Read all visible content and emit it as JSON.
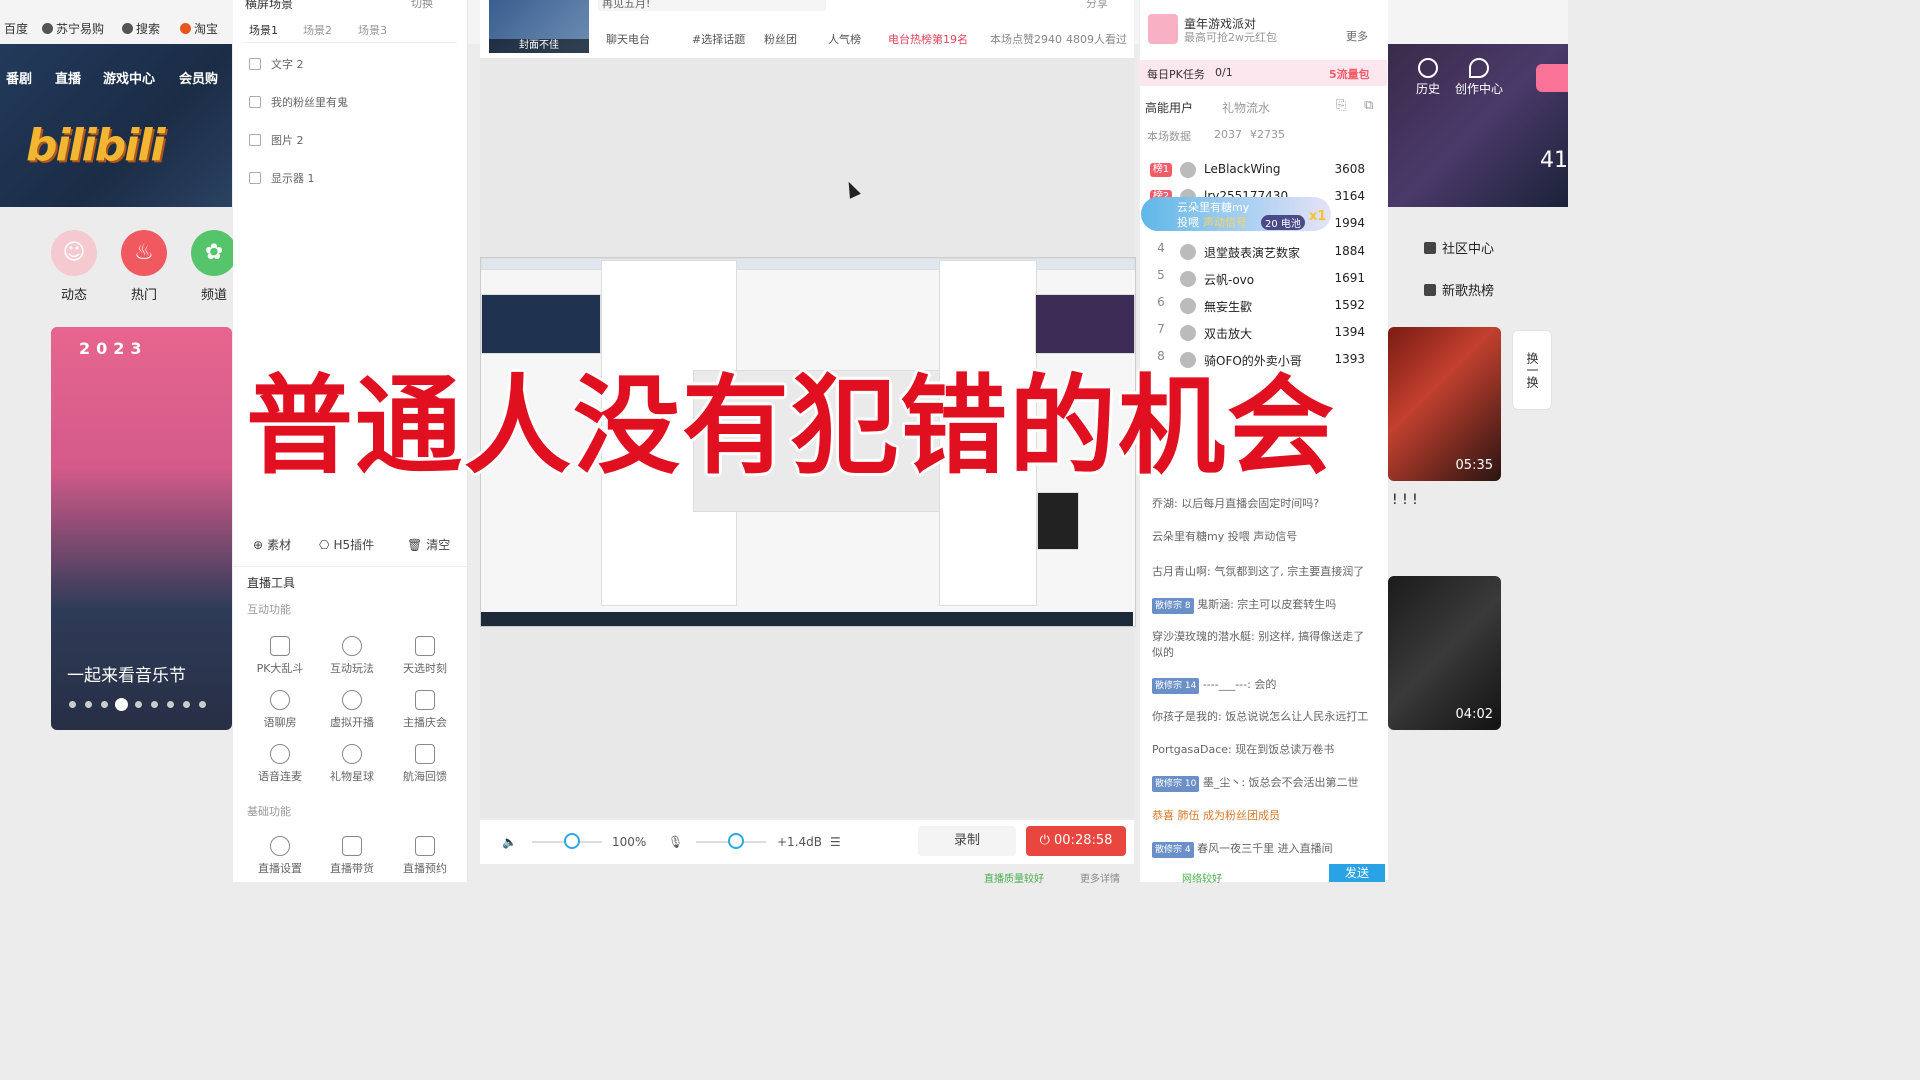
{
  "bookmarks": [
    "百度",
    "苏宁易购",
    "搜索",
    "淘宝"
  ],
  "site_nav": [
    "番剧",
    "直播",
    "游戏中心",
    "会员购"
  ],
  "logo_text": "bilibili",
  "header_right": {
    "history": "历史",
    "create": "创作中心",
    "number": "41"
  },
  "categories": [
    {
      "label": "动态",
      "icon": "avatar-icon"
    },
    {
      "label": "热门",
      "icon": "flame-icon"
    },
    {
      "label": "频道",
      "icon": "channel-icon"
    }
  ],
  "banner": {
    "year": "2023",
    "caption": "一起来看音乐节"
  },
  "right_links": [
    "社区中心",
    "新歌热榜"
  ],
  "refresh": {
    "label": "换一换"
  },
  "cards": [
    {
      "duration": "05:35"
    },
    {
      "duration": "04:02"
    }
  ],
  "exclaim": "! ! !",
  "scene": {
    "title": "横屏场景",
    "switch": "切换",
    "tabs": [
      "场景1",
      "场景2",
      "场景3"
    ],
    "sources": [
      "文字 2",
      "我的粉丝里有鬼",
      "图片 2",
      "显示器 1"
    ],
    "actions": [
      "素材",
      "H5插件",
      "清空"
    ],
    "tools_title": "直播工具",
    "interactive_title": "互动功能",
    "interactive_tools": [
      "PK大乱斗",
      "互动玩法",
      "天选时刻",
      "语聊房",
      "虚拟开播",
      "主播庆会",
      "语音连麦",
      "礼物星球",
      "航海回馈"
    ],
    "basic_title": "基础功能",
    "basic_tools": [
      "直播设置",
      "直播带货",
      "直播预约"
    ]
  },
  "stream": {
    "cover_label": "封面不佳",
    "title_partial": "再见五月!",
    "share": "分享",
    "tags": [
      "聊天电台",
      "#选择话题",
      "粉丝团",
      "人气榜",
      "电台热榜第19名"
    ],
    "likes": "本场点赞2940",
    "viewers": "4809人看过"
  },
  "controls": {
    "volume": "100%",
    "mic_gain": "+1.4dB",
    "record": "录制",
    "live_time": "00:28:58",
    "volume_level": 0.55,
    "mic_level": 0.55
  },
  "right": {
    "event_title": "童年游戏派对",
    "event_sub": "最高可抢2w元红包",
    "more": "更多",
    "pk_task": "每日PK任务",
    "pk_progress": "0/1",
    "pk_reward": "5流量包",
    "tab_high": "高能用户",
    "tab_gift": "礼物流水",
    "stats_label": "本场数据",
    "stats_users": "2037",
    "stats_money": "¥2735",
    "ranking": [
      {
        "rank": "榜1",
        "name": "LeBlackWing",
        "score": "3608"
      },
      {
        "rank": "榜2",
        "name": "lry255177430",
        "score": "3164"
      },
      {
        "rank": "3",
        "name": "",
        "score": "1994"
      },
      {
        "rank": "4",
        "name": "退堂鼓表演艺数家",
        "score": "1884"
      },
      {
        "rank": "5",
        "name": "云帆-ovo",
        "score": "1691"
      },
      {
        "rank": "6",
        "name": "無妄生歡",
        "score": "1592"
      },
      {
        "rank": "7",
        "name": "双击放大",
        "score": "1394"
      },
      {
        "rank": "8",
        "name": "骑OFO的外卖小哥",
        "score": "1393"
      }
    ],
    "gift_popup": {
      "user": "云朵里有糖my",
      "action": "投喂",
      "gift": "声动信号",
      "cost": "20 电池",
      "count": "x1"
    },
    "chat": [
      {
        "badge": "",
        "text": "乔湖: 以后每月直播会固定时间吗?"
      },
      {
        "badge": "",
        "text": "云朵里有糖my 投喂 声动信号"
      },
      {
        "badge": "",
        "text": "古月青山啊: 气氛都到这了, 宗主要直接润了"
      },
      {
        "badge": "散修宗 8",
        "text": "鬼斯涵: 宗主可以皮套转生吗"
      },
      {
        "badge": "",
        "text": "穿沙漠玫瑰的潜水艇: 别这样, 搞得像送走了似的"
      },
      {
        "badge": "散修宗 14",
        "text": "----___---: 会的"
      },
      {
        "badge": "",
        "text": "你孩子是我的: 饭总说说怎么让人民永远打工"
      },
      {
        "badge": "",
        "text": "PortgasaDace: 现在到饭总读万卷书"
      },
      {
        "badge": "散修宗 10",
        "text": "墨_尘丶: 饭总会不会活出第二世"
      },
      {
        "badge": "",
        "text": "恭喜 肺伍 成为粉丝团成员"
      },
      {
        "badge": "散修宗 4",
        "text": "春风一夜三千里 进入直播间"
      }
    ],
    "footer": [
      "网络较好",
      "直播质量较好",
      "更多详情"
    ],
    "send": "发送"
  },
  "overlay": {
    "headline": "普通人没有犯错的机会"
  }
}
